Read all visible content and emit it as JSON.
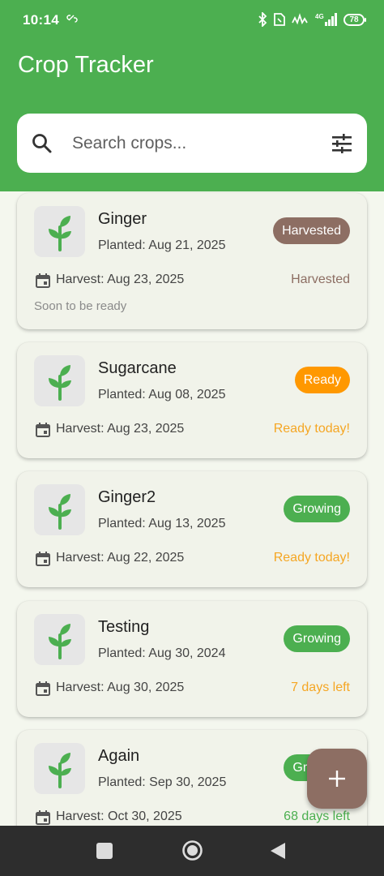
{
  "status_bar": {
    "time": "10:14",
    "battery": "78",
    "icons": [
      "link-icon",
      "bluetooth-icon",
      "nfc-icon",
      "volte-icon",
      "signal-4g-icon",
      "battery-icon"
    ]
  },
  "app": {
    "title": "Crop Tracker",
    "accent_color": "#4caf50",
    "fab_color": "#8d6e63"
  },
  "search": {
    "placeholder": "Search crops...",
    "value": ""
  },
  "crops": [
    {
      "name": "Ginger",
      "planted": "Planted: Aug 21, 2025",
      "status": "Harvested",
      "status_color": "#8d6e63",
      "harvest": "Harvest: Aug 23, 2025",
      "countdown": "Harvested",
      "countdown_color": "#8d6e63",
      "note": "Soon to be ready"
    },
    {
      "name": "Sugarcane",
      "planted": "Planted: Aug 08, 2025",
      "status": "Ready",
      "status_color": "#ff9800",
      "harvest": "Harvest: Aug 23, 2025",
      "countdown": "Ready today!",
      "countdown_color": "#f5a623"
    },
    {
      "name": "Ginger2",
      "planted": "Planted: Aug 13, 2025",
      "status": "Growing",
      "status_color": "#4caf50",
      "harvest": "Harvest: Aug 22, 2025",
      "countdown": "Ready today!",
      "countdown_color": "#f5a623"
    },
    {
      "name": "Testing",
      "planted": "Planted: Aug 30, 2024",
      "status": "Growing",
      "status_color": "#4caf50",
      "harvest": "Harvest: Aug 30, 2025",
      "countdown": "7 days left",
      "countdown_color": "#f5a623"
    },
    {
      "name": "Again",
      "planted": "Planted: Sep 30, 2025",
      "status": "Growing",
      "status_color": "#4caf50",
      "harvest": "Harvest: Oct 30, 2025",
      "countdown": "68 days left",
      "countdown_color": "#4caf50"
    }
  ]
}
